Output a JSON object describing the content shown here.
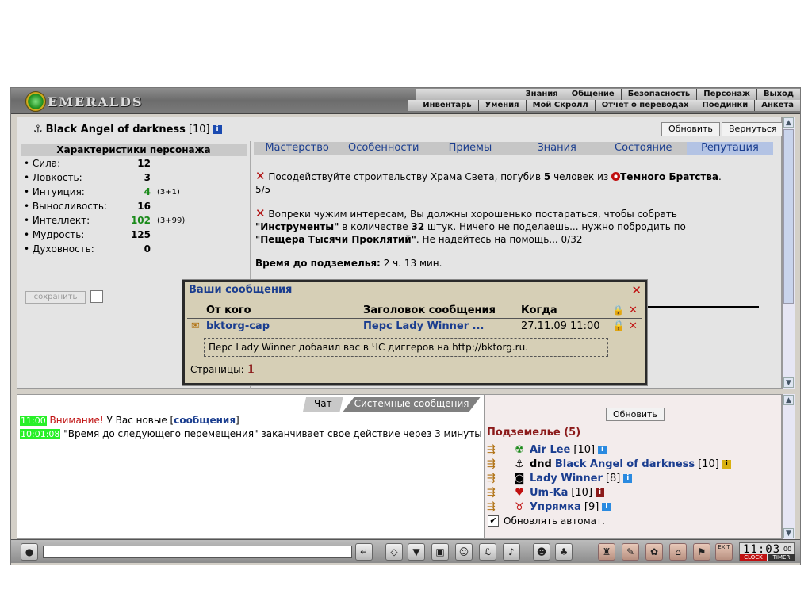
{
  "header": {
    "logo_text": "EMERALDS",
    "menu_top": [
      "Знания",
      "Общение",
      "Безопасность",
      "Персонаж",
      "Выход"
    ],
    "menu_bottom": [
      "Инвентарь",
      "Умения",
      "Мой Скролл",
      "Отчет о переводах",
      "Поединки",
      "Анкета"
    ]
  },
  "character": {
    "name": "Black Angel of darkness",
    "level": "[10]",
    "info": "i",
    "refresh_button": "Обновить",
    "back_button": "Вернуться"
  },
  "stats": {
    "title": "Характеристики персонажа",
    "items": [
      {
        "name": "Сила:",
        "value": "12",
        "extra": ""
      },
      {
        "name": "Ловкость:",
        "value": "3",
        "extra": ""
      },
      {
        "name": "Интуиция:",
        "value": "4",
        "extra": "(3+1)"
      },
      {
        "name": "Выносливость:",
        "value": "16",
        "extra": ""
      },
      {
        "name": "Интеллект:",
        "value": "102",
        "extra": "(3+99)"
      },
      {
        "name": "Мудрость:",
        "value": "125",
        "extra": ""
      },
      {
        "name": "Духовность:",
        "value": "0",
        "extra": ""
      }
    ],
    "save_button": "сохранить",
    "bullet": "•"
  },
  "tabs": [
    "Мастерство",
    "Особенности",
    "Приемы",
    "Знания",
    "Состояние",
    "Репутация"
  ],
  "quests": {
    "q1_a": "Посодействуйте строительству Храма Света, погубив",
    "q1_num": "5",
    "q1_b": "человек из",
    "q1_org": "Темного Братства",
    "q1_end": ".",
    "q1_progress": "5/5",
    "q2_a": "Вопреки чужим интересам, Вы должны хорошенько постараться, чтобы собрать",
    "q2_item": "\"Инструменты\"",
    "q2_b": "в количестве",
    "q2_num": "32",
    "q2_c": "штук. Ничего не поделаешь... нужно побродить по",
    "q2_place": "\"Пещера Тысячи Проклятий\"",
    "q2_d": ". Не надейтесь на помощь... 0/32",
    "timer_label": "Время до подземелья:",
    "timer_value": "2 ч. 13 мин."
  },
  "messages": {
    "title": "Ваши сообщения",
    "col_from": "От кого",
    "col_subject": "Заголовок сообщения",
    "col_when": "Когда",
    "row_from": "bktorg-cap",
    "row_subject": "Перс Lady Winner ...",
    "row_when": "27.11.09 11:00",
    "body": "Перс Lady Winner добавил вас в ЧС диггеров на http://bktorg.ru.",
    "pages_label": "Страницы:",
    "pages_value": "1"
  },
  "chat": {
    "tab_chat": "Чат",
    "tab_system": "Системные сообщения",
    "line1_time": "11:00",
    "line1_warn": "Внимание!",
    "line1_text": "У Вас новые [",
    "line1_link": "сообщения",
    "line1_end": "]",
    "line2_time": "10:01:08",
    "line2_text": "\"Время до следующего перемещения\" заканчивает свое действие через 3 минуты"
  },
  "dungeon": {
    "refresh_button": "Обновить",
    "title": "Подземелье (5)",
    "players": [
      {
        "prefix": "",
        "name": "Air Lee",
        "level": "[10]",
        "info_color": "blue"
      },
      {
        "prefix": "dnd",
        "name": "Black Angel of darkness",
        "level": "[10]",
        "info_color": "yellow"
      },
      {
        "prefix": "",
        "name": "Lady Winner",
        "level": "[8]",
        "info_color": "blue"
      },
      {
        "prefix": "",
        "name": "Um-Ka",
        "level": "[10]",
        "info_color": "red"
      },
      {
        "prefix": "",
        "name": "Упрямка",
        "level": "[9]",
        "info_color": "blue"
      }
    ],
    "auto_refresh_label": "Обновлять автомат.",
    "auto_refresh_checked": "✔"
  },
  "clock": {
    "time": "11:03",
    "seconds": "00",
    "clock_label": "CLOCK",
    "timer_label": "TIMER",
    "exit_label": "EXIT"
  }
}
